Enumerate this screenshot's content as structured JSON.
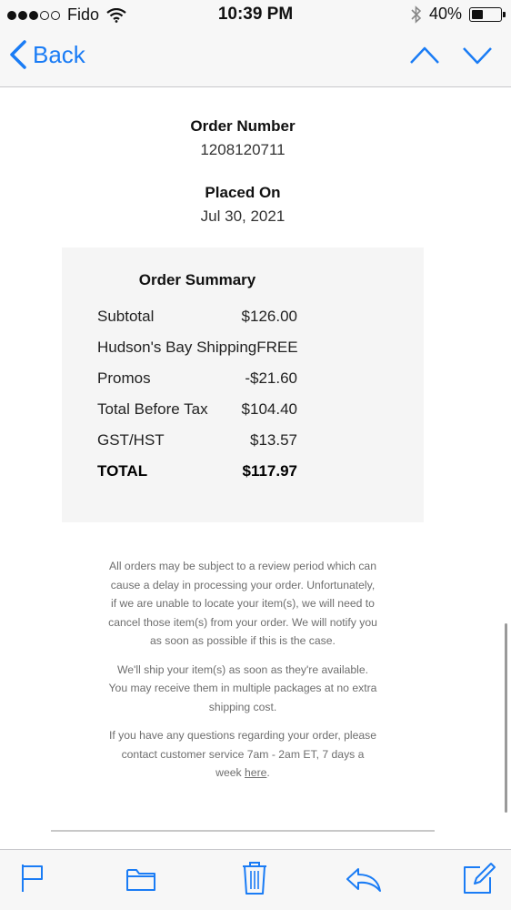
{
  "status_bar": {
    "carrier": "Fido",
    "time": "10:39 PM",
    "battery_percent": "40%",
    "battery_level": 0.4
  },
  "nav": {
    "back_label": "Back"
  },
  "order": {
    "number_label": "Order Number",
    "number_value": "1208120711",
    "placed_label": "Placed On",
    "placed_value": "Jul 30, 2021"
  },
  "summary": {
    "title": "Order Summary",
    "rows": [
      {
        "label": "Subtotal",
        "value": "$126.00"
      },
      {
        "label": "Hudson's Bay Shipping",
        "value": "FREE"
      },
      {
        "label": "Promos",
        "value": "-$21.60"
      },
      {
        "label": "Total Before Tax",
        "value": "$104.40"
      },
      {
        "label": "GST/HST",
        "value": "$13.57"
      },
      {
        "label": "TOTAL",
        "value": "$117.97"
      }
    ]
  },
  "notes": {
    "p1": "All orders may be subject to a review period which can cause a delay in processing your order. Unfortunately, if we are unable to locate your item(s), we will need to cancel those item(s) from your order. We will notify you as soon as possible if this is the case.",
    "p2": "We'll ship your item(s) as soon as they're available. You may receive them in multiple packages at no extra shipping cost.",
    "p3_text": "If you have any questions regarding your order, please contact customer service 7am - 2am ET, 7 days a week ",
    "p3_link": "here",
    "p3_end": "."
  },
  "colors": {
    "accent": "#1a7cf5",
    "summary_bg": "#f5f5f5",
    "note_text": "#6e6e6e"
  },
  "toolbar": {
    "icons": [
      "flag-icon",
      "folder-icon",
      "trash-icon",
      "reply-icon",
      "compose-icon"
    ]
  }
}
